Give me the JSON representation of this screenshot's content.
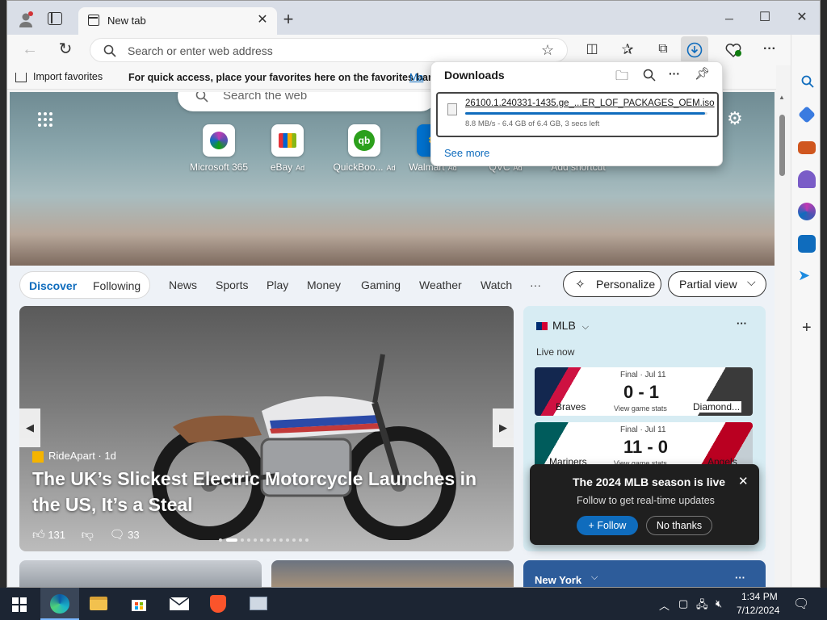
{
  "window": {
    "tab_title": "New tab",
    "new_tab_symbol": "+",
    "minimize": "─",
    "maximize": "☐",
    "close": "✕"
  },
  "toolbar": {
    "address_placeholder": "Search or enter web address"
  },
  "favorites_bar": {
    "import_label": "Import favorites",
    "hint": "For quick access, place your favorites here on the favorites bar.",
    "manage_link": "Ma"
  },
  "downloads": {
    "title": "Downloads",
    "file_name": "26100.1.240331-1435.ge_...ER_LOF_PACKAGES_OEM.iso",
    "status": "8.8 MB/s - 6.4 GB of 6.4 GB, 3 secs left",
    "progress_fraction": 0.99,
    "see_more": "See more"
  },
  "new_tab_page": {
    "search_placeholder": "Search the web",
    "tiles": [
      {
        "label": "Microsoft 365",
        "ad": ""
      },
      {
        "label": "eBay",
        "ad": "Ad"
      },
      {
        "label": "QuickBoo...",
        "ad": "Ad"
      },
      {
        "label": "Walmart",
        "ad": "Ad"
      },
      {
        "label": "QVC",
        "ad": "Ad"
      },
      {
        "label": "Add shortcut",
        "ad": ""
      }
    ],
    "feed_tabs": [
      "Discover",
      "Following"
    ],
    "categories": [
      "News",
      "Sports",
      "Play",
      "Money",
      "Gaming",
      "Weather",
      "Watch"
    ],
    "more": "···",
    "personalize": "Personalize",
    "partial_view": "Partial view"
  },
  "main_story": {
    "source": "RideApart",
    "age": "1d",
    "headline": "The UK’s Slickest Electric Motorcycle Launches in the US, It’s a Steal",
    "likes": "131",
    "comments": "33"
  },
  "mlb": {
    "league": "MLB",
    "live_now": "Live now",
    "game1": {
      "status": "Final · Jul 11",
      "score": "0 - 1",
      "link": "View game stats",
      "home": "Braves",
      "away": "Diamond..."
    },
    "game2": {
      "status": "Final · Jul 11",
      "score": "11 - 0",
      "link": "View game stats",
      "home": "Mariners",
      "away": "Angels"
    },
    "popup_title": "The 2024 MLB season is live",
    "popup_text": "Follow to get real-time updates",
    "follow": "Follow",
    "no_thanks": "No thanks"
  },
  "weather_card": {
    "city": "New York"
  },
  "taskbar": {
    "time": "1:34 PM",
    "date": "7/12/2024"
  },
  "colors": {
    "accent": "#0f6cbd",
    "taskbar": "#1c2533",
    "mlb_bg": "#d7ecf3"
  }
}
